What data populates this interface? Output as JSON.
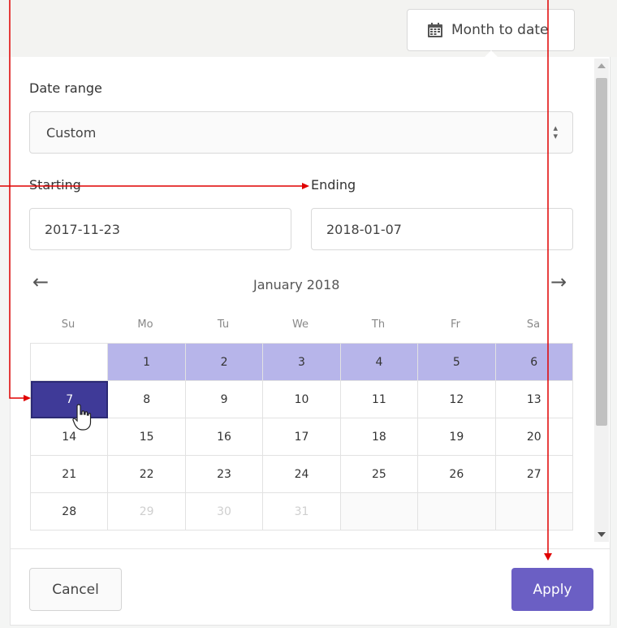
{
  "topbar": {
    "preset_button_label": "Month to date"
  },
  "form": {
    "date_range_label": "Date range",
    "date_range_value": "Custom",
    "starting_label": "Starting",
    "ending_label": "Ending",
    "starting_value": "2017-11-23",
    "ending_value": "2018-01-07"
  },
  "calendar": {
    "month_label": "January 2018",
    "prev_arrow": "←",
    "next_arrow": "→",
    "weekdays": [
      "Su",
      "Mo",
      "Tu",
      "We",
      "Th",
      "Fr",
      "Sa"
    ],
    "weeks": [
      [
        "",
        "1",
        "2",
        "3",
        "4",
        "5",
        "6"
      ],
      [
        "7",
        "8",
        "9",
        "10",
        "11",
        "12",
        "13"
      ],
      [
        "14",
        "15",
        "16",
        "17",
        "18",
        "19",
        "20"
      ],
      [
        "21",
        "22",
        "23",
        "24",
        "25",
        "26",
        "27"
      ],
      [
        "28",
        "29",
        "30",
        "31",
        "",
        "",
        ""
      ]
    ],
    "in_range_days": [
      "1",
      "2",
      "3",
      "4",
      "5",
      "6"
    ],
    "selected_day": "7",
    "muted_days": [
      "29",
      "30",
      "31"
    ]
  },
  "footer": {
    "cancel_label": "Cancel",
    "apply_label": "Apply"
  },
  "colors": {
    "range": "#b7b5ea",
    "selected": "#3f3a98",
    "apply": "#6b5fc4",
    "annotation": "#e00000"
  },
  "icons": {
    "preset": "calendar-icon",
    "select": "up-down-caret-icon",
    "cursor": "hand-pointer-icon"
  }
}
